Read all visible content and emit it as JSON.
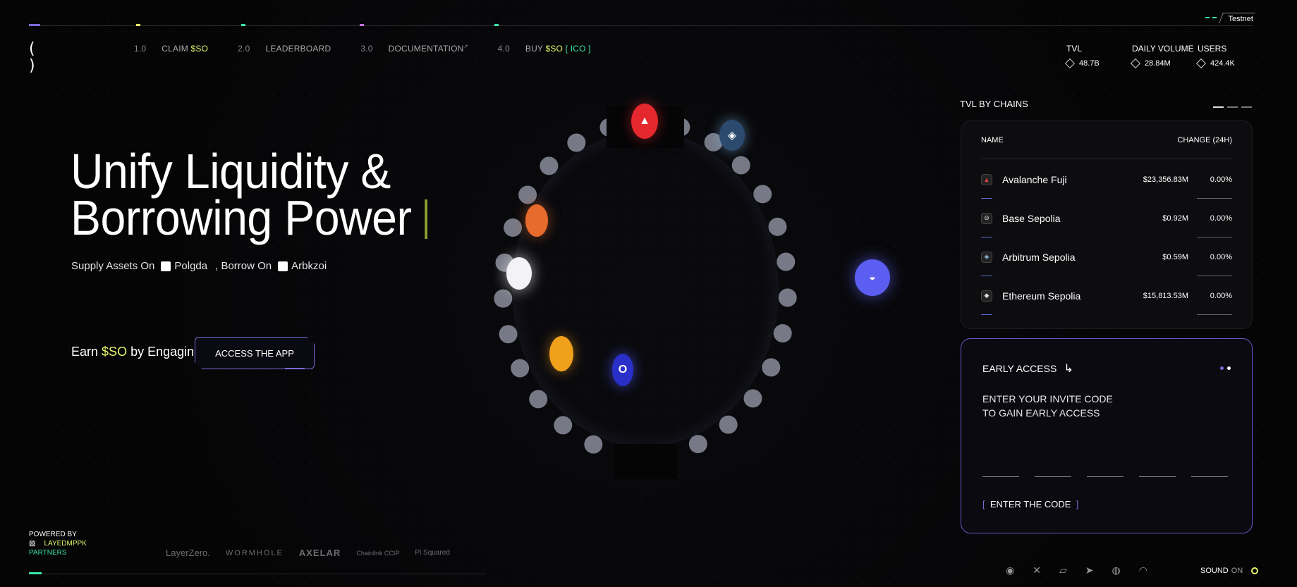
{
  "header": {
    "testnet_label": "Testnet",
    "logo_glyph": "( )",
    "nav": [
      {
        "num": "1.0",
        "label": "CLAIM",
        "highlight": "$SO"
      },
      {
        "num": "2.0",
        "label": "LEADERBOARD"
      },
      {
        "num": "3.0",
        "label": "DOCUMENTATION",
        "sup": "↗"
      },
      {
        "num": "4.0",
        "label": "BUY",
        "highlight": "$SO",
        "tag": "[ ICO ]"
      }
    ],
    "stats": [
      {
        "label": "TVL",
        "value": "48.7B"
      },
      {
        "label": "DAILY VOLUME",
        "value": "28.84M"
      },
      {
        "label": "USERS",
        "value": "424.4K"
      }
    ]
  },
  "hero": {
    "title_line1": "Unify Liquidity &",
    "title_line2": "Borrowing Power",
    "sub_supply": "Supply Assets On",
    "sub_chain1": "Polgda",
    "sub_borrow": ", Borrow On",
    "sub_chain2": "Arbkzoi",
    "earn_prefix": "Earn",
    "earn_token": "$SO",
    "earn_suffix": "by Engaging",
    "access_button": "ACCESS THE APP"
  },
  "tvl_by_chains": {
    "title": "TVL BY CHAINS",
    "col_name": "NAME",
    "col_change": "CHANGE (24H)",
    "rows": [
      {
        "name": "Avalanche Fuji",
        "amount": "$23,356.83M",
        "change": "0.00%",
        "icon": "avalanche-icon",
        "glyph": "▲",
        "color": "#e84142"
      },
      {
        "name": "Base Sepolia",
        "amount": "$0.92M",
        "change": "0.00%",
        "icon": "base-icon",
        "glyph": "⊖",
        "color": "#cccccc"
      },
      {
        "name": "Arbitrum Sepolia",
        "amount": "$0.59M",
        "change": "0.00%",
        "icon": "arbitrum-icon",
        "glyph": "◈",
        "color": "#9dcced"
      },
      {
        "name": "Ethereum Sepolia",
        "amount": "$15,813.53M",
        "change": "0.00%",
        "icon": "ethereum-icon",
        "glyph": "◆",
        "color": "#bbbbbb"
      }
    ]
  },
  "early_access": {
    "title": "EARLY ACCESS",
    "arrow": "↳",
    "line1": "ENTER YOUR INVITE CODE",
    "line2": "TO GAIN EARLY ACCESS",
    "button": "ENTER THE CODE",
    "colors": {
      "dot1": "#7b6bd8",
      "dot2": "#ffffff"
    }
  },
  "footer": {
    "powered_by": "POWERED BY",
    "brand": "LAYEDMPPK",
    "partners_label": "PARTNERS",
    "partner_logos": [
      "LayerZero.",
      "WORMHOLE",
      "AXELAR",
      "Chainlink CCIP",
      "Pi Squared"
    ],
    "socials": [
      "discord-icon",
      "x-icon",
      "gitbook-icon",
      "telegram-icon",
      "github-icon",
      "ghost-icon"
    ],
    "sound_label": "SOUND",
    "sound_state": "ON"
  },
  "colors": {
    "accent_yellow": "#e6f56a",
    "accent_green": "#3be6a8",
    "accent_purple": "#7b6bd8",
    "background": "#050506"
  }
}
